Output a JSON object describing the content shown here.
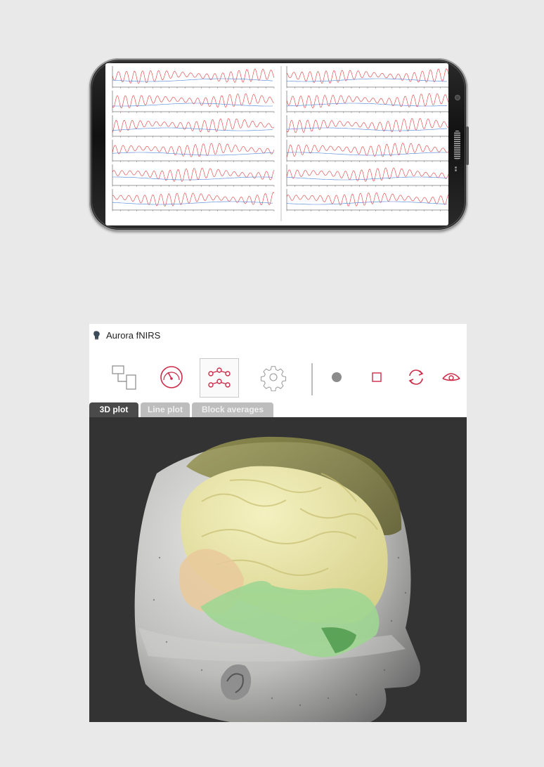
{
  "app": {
    "title": "Aurora fNIRS",
    "toolbar": [
      {
        "name": "hardware-connect-icon"
      },
      {
        "name": "gauge-icon"
      },
      {
        "name": "network-nodes-icon",
        "active": true
      },
      {
        "name": "settings-gear-icon"
      },
      {
        "name": "record-dot-icon"
      },
      {
        "name": "stop-square-icon"
      },
      {
        "name": "refresh-cycle-icon"
      },
      {
        "name": "eye-view-icon"
      }
    ],
    "tabs": [
      {
        "label": "3D plot",
        "selected": true
      },
      {
        "label": "Line plot",
        "selected": false
      },
      {
        "label": "Block averages",
        "selected": false
      }
    ]
  },
  "phone_plot": {
    "columns": 2,
    "rows_per_column": 6,
    "series_colors": {
      "oxy": "#e33b3b",
      "deoxy": "#4a7fd6"
    }
  },
  "colors": {
    "accent": "#cc2c49",
    "background": "#e9e9e9",
    "plot_bg": "#333333"
  }
}
